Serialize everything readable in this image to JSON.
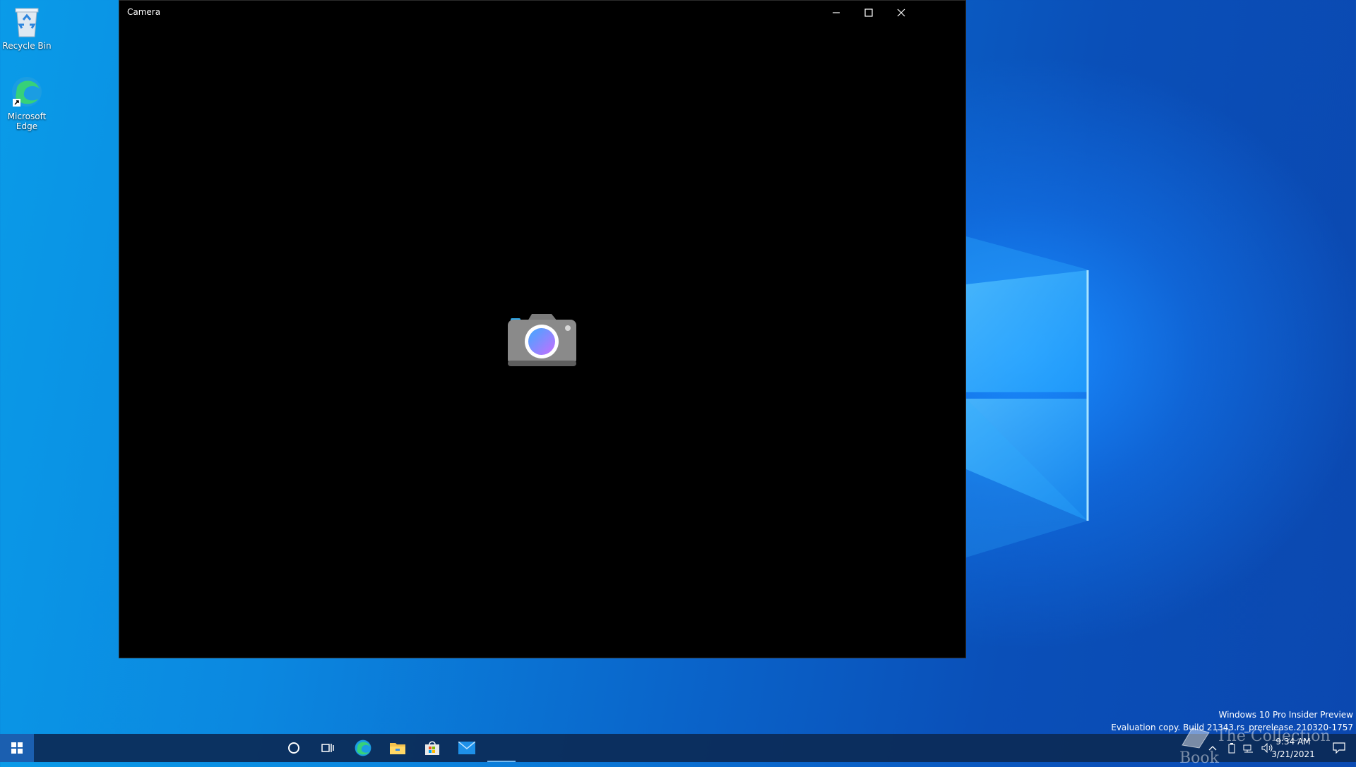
{
  "desktop": {
    "icons": [
      {
        "label": "Recycle Bin",
        "icon": "recycle-bin-icon"
      },
      {
        "label_line1": "Microsoft",
        "label_line2": "Edge",
        "icon": "edge-icon"
      }
    ]
  },
  "window": {
    "title": "Camera",
    "controls": [
      "minimize",
      "maximize",
      "close"
    ],
    "background": "#000000"
  },
  "watermark": {
    "line1": "Windows 10 Pro Insider Preview",
    "line2": "Evaluation copy. Build 21343.rs_prerelease.210320-1757"
  },
  "overlay": {
    "text": "The Collection Book"
  },
  "taskbar": {
    "items": [
      "start-icon",
      "cortana-icon",
      "task-view-icon",
      "edge-icon",
      "file-explorer-icon",
      "store-icon",
      "mail-icon",
      "camera-app-icon"
    ],
    "time": "9:34 AM",
    "date": "3/21/2021"
  },
  "colors": {
    "accent": "#0a63c9",
    "taskbar": "#0c2a56",
    "active_indicator": "#76b9ed"
  }
}
